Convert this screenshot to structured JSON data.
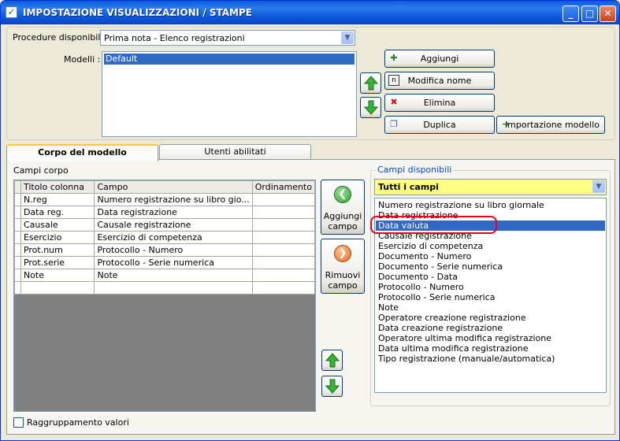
{
  "window": {
    "title": "IMPOSTAZIONE VISUALIZZAZIONI / STAMPE",
    "minimize_label": "_",
    "maximize_label": "□",
    "close_label": "✕"
  },
  "procedures": {
    "label": "Procedure disponibili :",
    "selected": "Prima nota - Elenco registrazioni"
  },
  "models": {
    "label": "Modelli :",
    "items": [
      "Default"
    ]
  },
  "buttons": {
    "add": "Aggiungi",
    "rename": "Modifica nome",
    "delete": "Elimina",
    "duplicate": "Duplica",
    "import_model": "Importazione modello"
  },
  "tabs": [
    {
      "label": "Corpo del modello"
    },
    {
      "label": "Utenti abilitati"
    }
  ],
  "body_fields": {
    "label": "Campi corpo",
    "columns": [
      "Titolo colonna",
      "Campo",
      "Ordinamento"
    ],
    "rows": [
      {
        "title": "N.reg",
        "field": "Numero registrazione su libro gio...",
        "sort": ""
      },
      {
        "title": "Data reg.",
        "field": "Data registrazione",
        "sort": ""
      },
      {
        "title": "Causale",
        "field": "Causale registrazione",
        "sort": ""
      },
      {
        "title": "Esercizio",
        "field": "Esercizio di competenza",
        "sort": ""
      },
      {
        "title": "Prot.num",
        "field": "Protocollo - Numero",
        "sort": ""
      },
      {
        "title": "Prot.serie",
        "field": "Protocollo - Serie numerica",
        "sort": ""
      },
      {
        "title": "Note",
        "field": "Note",
        "sort": ""
      },
      {
        "title": "",
        "field": "",
        "sort": ""
      }
    ]
  },
  "field_actions": {
    "add": "Aggiungi campo",
    "remove": "Rimuovi campo"
  },
  "available_fields": {
    "label": "Campi disponibili",
    "filter": "Tutti i campi",
    "selected_index": 2,
    "items": [
      "Numero registrazione su libro giornale",
      "Data registrazione",
      "Data valuta",
      "Causale registrazione",
      "Esercizio di competenza",
      "Documento - Numero",
      "Documento - Serie numerica",
      "Documento - Data",
      "Protocollo - Numero",
      "Protocollo - Serie numerica",
      "Note",
      "Operatore creazione registrazione",
      "Data creazione registrazione",
      "Operatore ultima modifica registrazione",
      "Data ultima modifica registrazione",
      "Tipo registrazione (manuale/automatica)"
    ]
  },
  "grouping": {
    "label": "Raggruppamento valori",
    "checked": false
  },
  "colors": {
    "selection": "#316ac5",
    "highlight_ring": "#e8001c",
    "filter_bg": "#ffff80"
  }
}
